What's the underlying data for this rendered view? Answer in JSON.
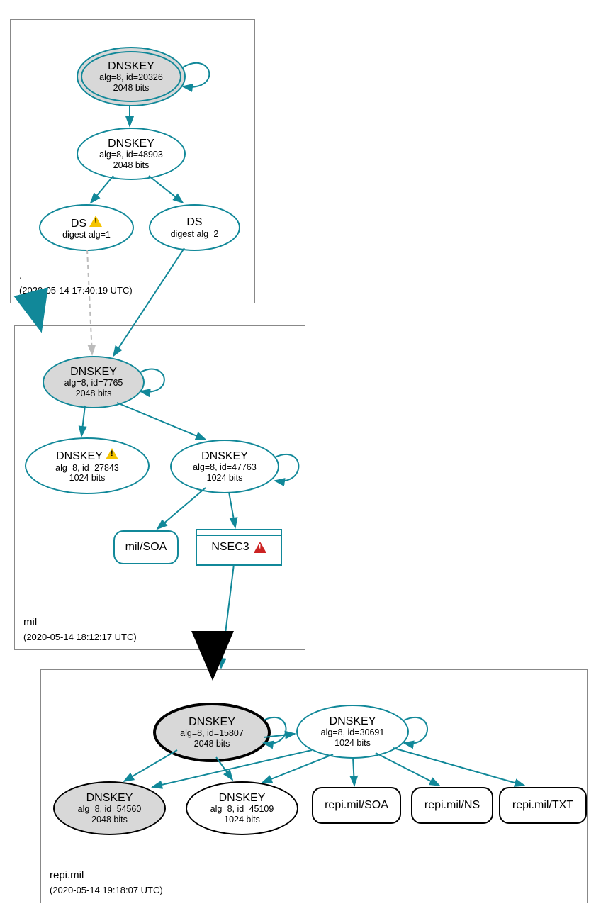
{
  "zones": {
    "root": {
      "label": ".",
      "timestamp": "(2020-05-14 17:40:19 UTC)"
    },
    "mil": {
      "label": "mil",
      "timestamp": "(2020-05-14 18:12:17 UTC)"
    },
    "repi": {
      "label": "repi.mil",
      "timestamp": "(2020-05-14 19:18:07 UTC)"
    }
  },
  "nodes": {
    "root_ksk": {
      "title": "DNSKEY",
      "line2": "alg=8, id=20326",
      "line3": "2048 bits"
    },
    "root_zsk": {
      "title": "DNSKEY",
      "line2": "alg=8, id=48903",
      "line3": "2048 bits"
    },
    "root_ds1": {
      "title": "DS",
      "line2": "digest alg=1"
    },
    "root_ds2": {
      "title": "DS",
      "line2": "digest alg=2"
    },
    "mil_ksk": {
      "title": "DNSKEY",
      "line2": "alg=8, id=7765",
      "line3": "2048 bits"
    },
    "mil_k2": {
      "title": "DNSKEY",
      "line2": "alg=8, id=27843",
      "line3": "1024 bits"
    },
    "mil_k3": {
      "title": "DNSKEY",
      "line2": "alg=8, id=47763",
      "line3": "1024 bits"
    },
    "mil_soa": {
      "label": "mil/SOA"
    },
    "mil_nsec3": {
      "label": "NSEC3"
    },
    "repi_ksk": {
      "title": "DNSKEY",
      "line2": "alg=8, id=15807",
      "line3": "2048 bits"
    },
    "repi_zsk": {
      "title": "DNSKEY",
      "line2": "alg=8, id=30691",
      "line3": "1024 bits"
    },
    "repi_k3": {
      "title": "DNSKEY",
      "line2": "alg=8, id=54560",
      "line3": "2048 bits"
    },
    "repi_k4": {
      "title": "DNSKEY",
      "line2": "alg=8, id=45109",
      "line3": "1024 bits"
    },
    "repi_soa": {
      "label": "repi.mil/SOA"
    },
    "repi_ns": {
      "label": "repi.mil/NS"
    },
    "repi_txt": {
      "label": "repi.mil/TXT"
    }
  }
}
